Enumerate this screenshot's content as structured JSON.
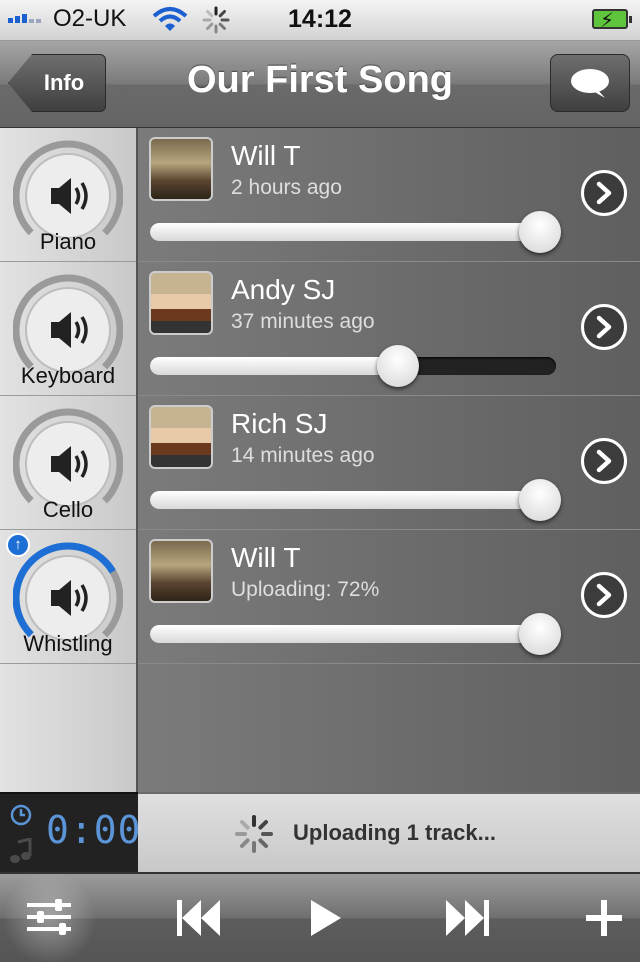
{
  "status_bar": {
    "carrier": "O2-UK",
    "time": "14:12",
    "battery_state": "charging"
  },
  "nav": {
    "back_label": "Info",
    "title": "Our First Song",
    "chat_icon": "speech-bubble-icon"
  },
  "tracks": [
    {
      "instrument": "Piano",
      "user": "Will T",
      "status": "2 hours ago",
      "volume": 0.96,
      "uploading": false,
      "progress": 0
    },
    {
      "instrument": "Keyboard",
      "user": "Andy SJ",
      "status": "37 minutes ago",
      "volume": 0.61,
      "uploading": false,
      "progress": 0
    },
    {
      "instrument": "Cello",
      "user": "Rich SJ",
      "status": "14 minutes ago",
      "volume": 0.96,
      "uploading": false,
      "progress": 0
    },
    {
      "instrument": "Whistling",
      "user": "Will T",
      "status": "Uploading: 72%",
      "volume": 0.96,
      "uploading": true,
      "progress": 0.72
    }
  ],
  "footer": {
    "timer": "0:00",
    "upload_status": "Uploading 1 track..."
  },
  "toolbar": {
    "buttons": [
      "mixer-icon",
      "rewind-icon",
      "play-icon",
      "fast-forward-icon",
      "add-icon"
    ]
  },
  "colors": {
    "accent_blue": "#1d6fd6",
    "timer_blue": "#5b95d8",
    "battery_green": "#5ec43b"
  }
}
